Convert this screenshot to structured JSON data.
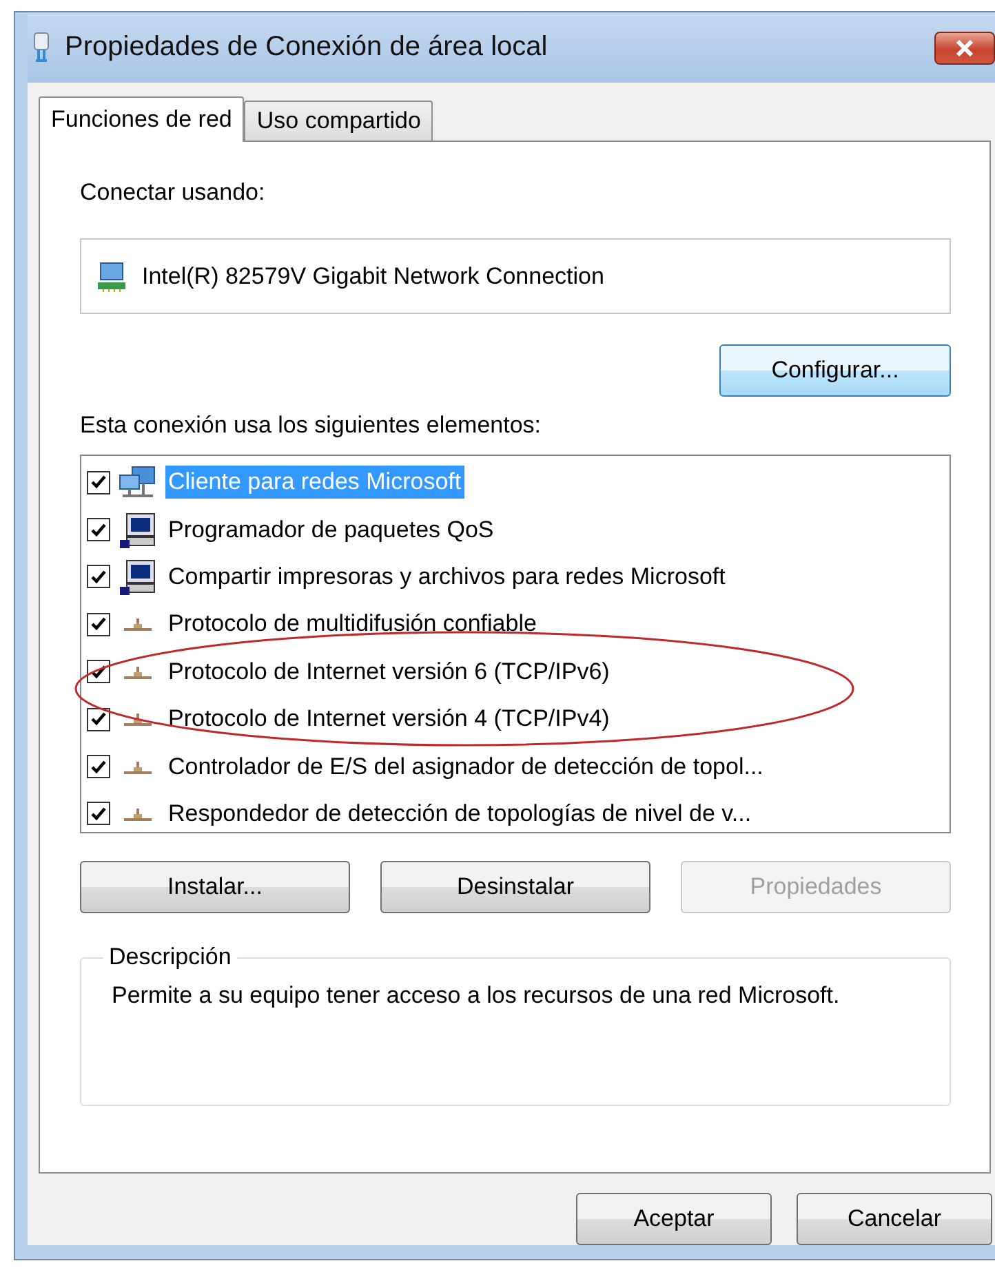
{
  "window": {
    "title": "Propiedades de Conexión de área local"
  },
  "tabs": [
    {
      "label": "Funciones de red",
      "selected": true
    },
    {
      "label": "Uso compartido",
      "selected": false
    }
  ],
  "connect_using": {
    "label": "Conectar usando:",
    "adapter": "Intel(R) 82579V Gigabit Network Connection",
    "button": "Configurar..."
  },
  "components": {
    "label": "Esta conexión usa los siguientes elementos:",
    "items": [
      {
        "kind": "client",
        "label": "Cliente para redes Microsoft",
        "checked": true,
        "selected": true
      },
      {
        "kind": "service",
        "label": "Programador de paquetes QoS",
        "checked": true,
        "selected": false
      },
      {
        "kind": "service",
        "label": "Compartir impresoras y archivos para redes Microsoft",
        "checked": true,
        "selected": false
      },
      {
        "kind": "protocol",
        "label": "Protocolo de multidifusión confiable",
        "checked": true,
        "selected": false
      },
      {
        "kind": "protocol",
        "label": "Protocolo de Internet versión 6 (TCP/IPv6)",
        "checked": true,
        "selected": false
      },
      {
        "kind": "protocol",
        "label": "Protocolo de Internet versión 4 (TCP/IPv4)",
        "checked": true,
        "selected": false
      },
      {
        "kind": "protocol",
        "label": "Controlador de E/S del asignador de detección de topol...",
        "checked": true,
        "selected": false
      },
      {
        "kind": "protocol",
        "label": "Respondedor de detección de topologías de nivel de v...",
        "checked": true,
        "selected": false
      }
    ]
  },
  "buttons": [
    {
      "label": "Instalar...",
      "disabled": false
    },
    {
      "label": "Desinstalar",
      "disabled": false
    },
    {
      "label": "Propiedades",
      "disabled": true
    }
  ],
  "description": {
    "title": "Descripción",
    "text": "Permite a su equipo tener acceso a los recursos de una red Microsoft."
  },
  "dialog_buttons": [
    {
      "label": "Aceptar"
    },
    {
      "label": "Cancelar"
    }
  ]
}
